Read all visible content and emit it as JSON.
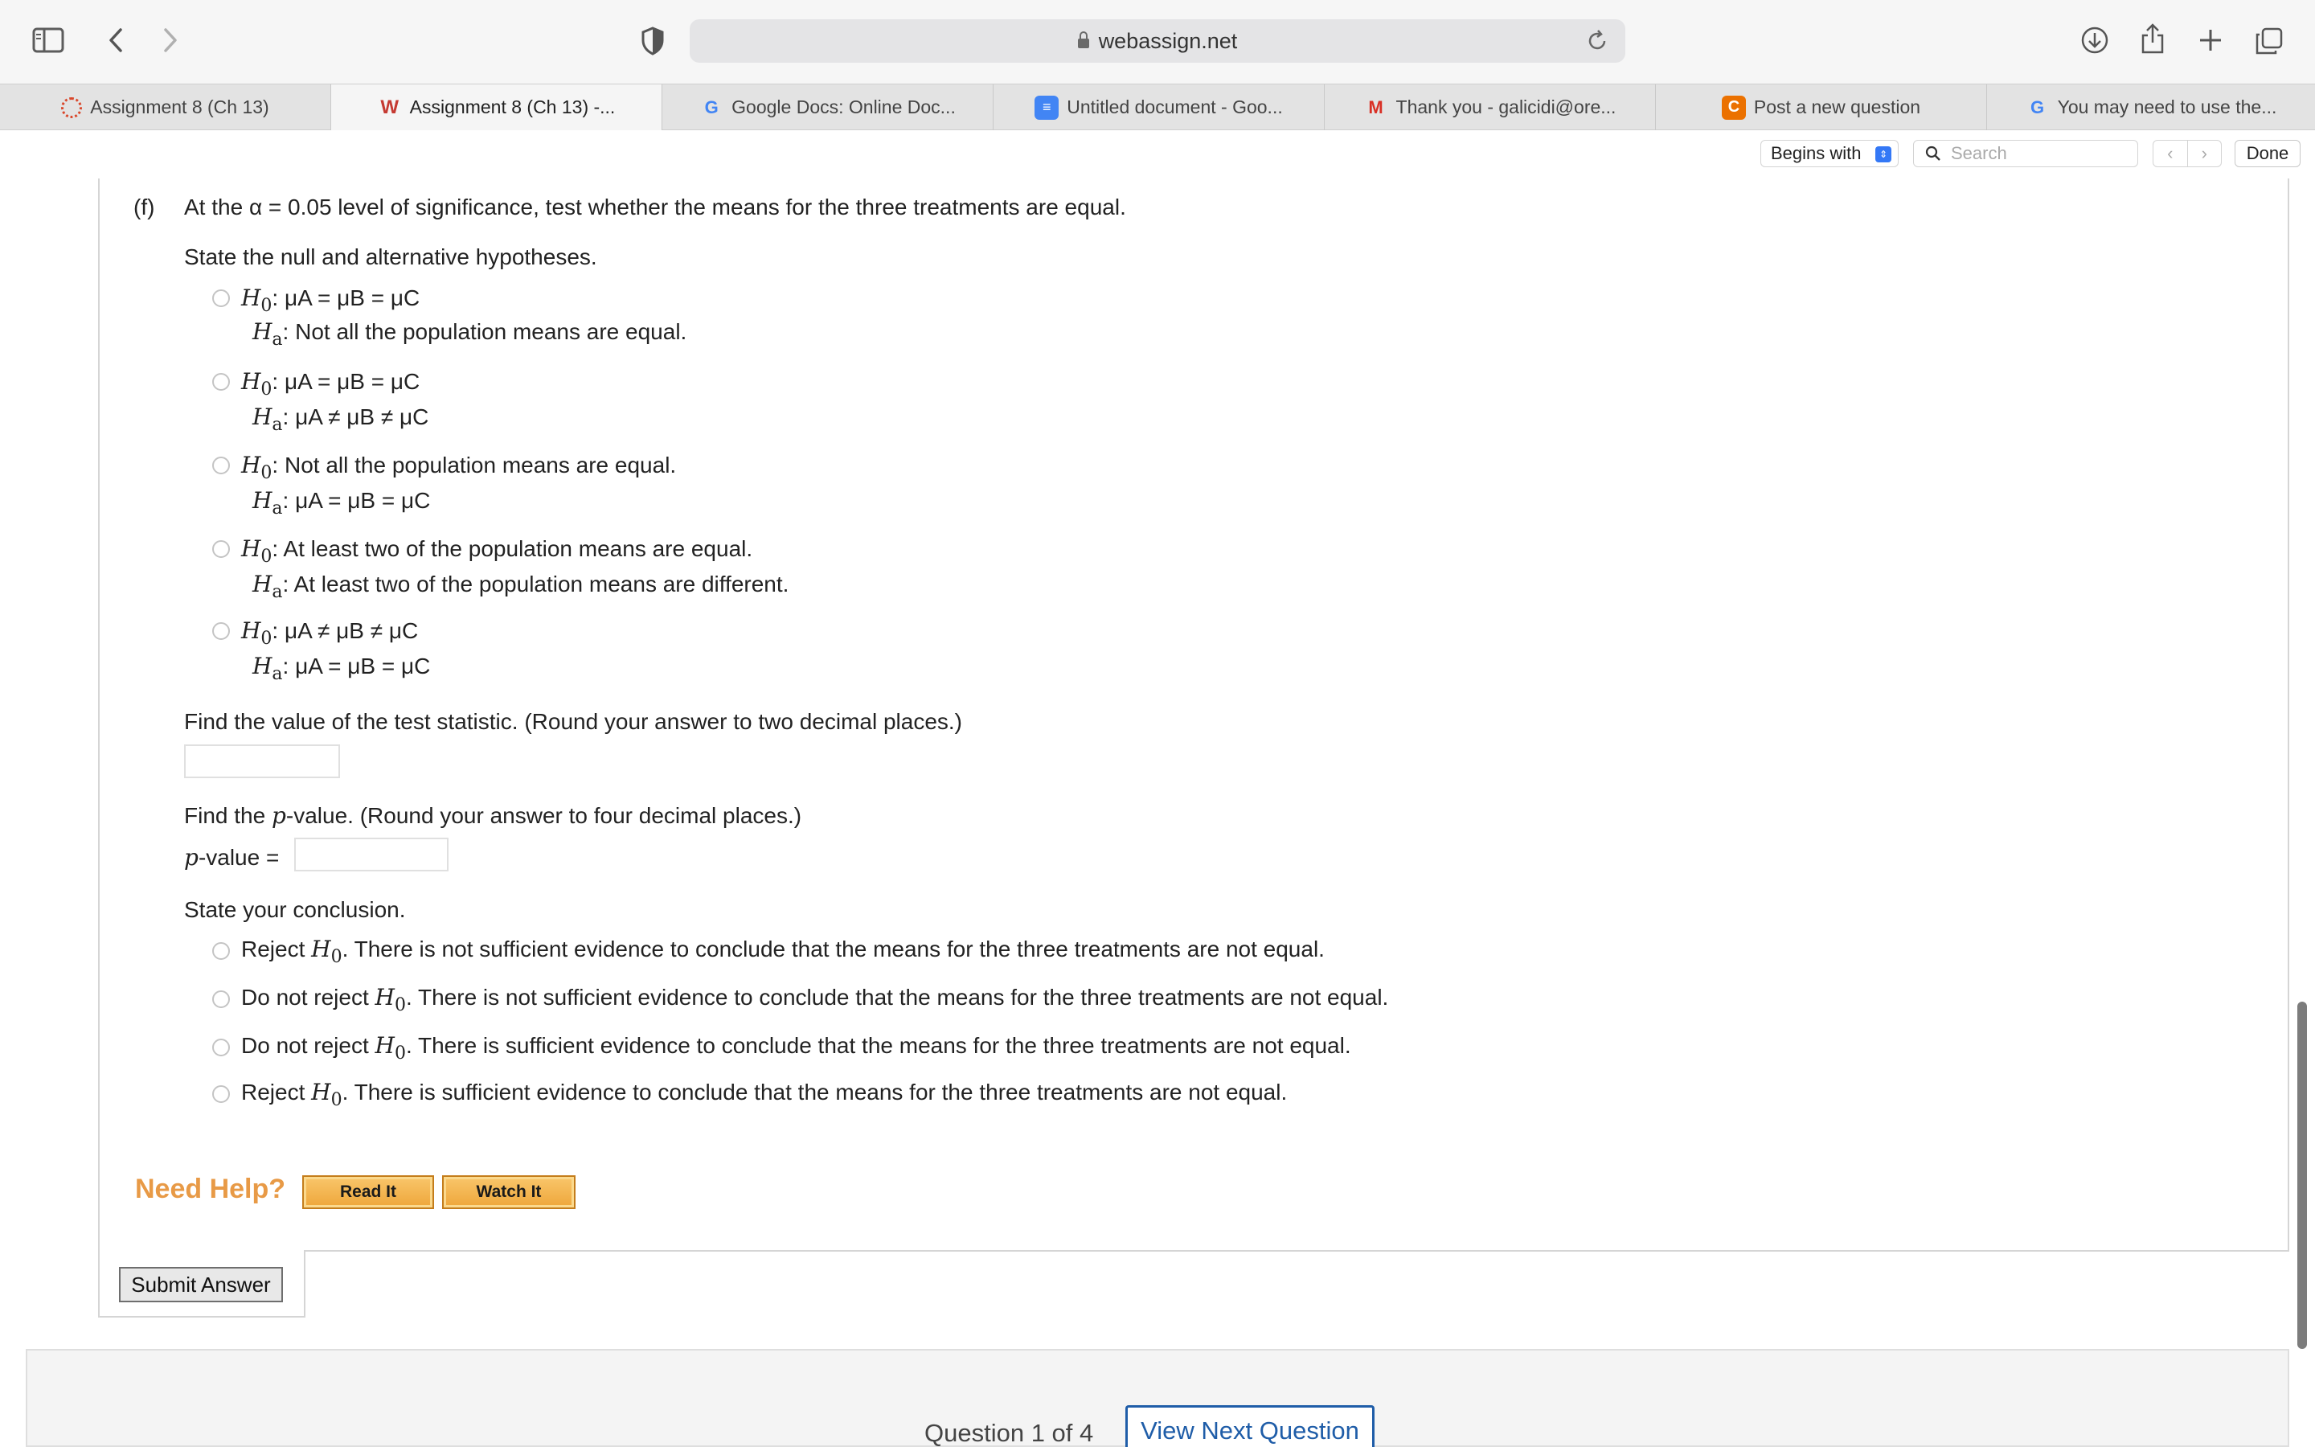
{
  "browser": {
    "url": "webassign.net"
  },
  "tabs": [
    {
      "label": "Assignment 8 (Ch 13)",
      "icon": "wa-gear-icon"
    },
    {
      "label": "Assignment 8 (Ch 13) -...",
      "icon": "wa-logo-icon"
    },
    {
      "label": "Google Docs: Online Doc...",
      "icon": "google-icon"
    },
    {
      "label": "Untitled document - Goo...",
      "icon": "docs-icon"
    },
    {
      "label": "Thank you - galicidi@ore...",
      "icon": "gmail-icon"
    },
    {
      "label": "Post a new question",
      "icon": "chegg-icon"
    },
    {
      "label": "You may need to use the...",
      "icon": "google-icon"
    }
  ],
  "findbar": {
    "mode": "Begins with",
    "search_placeholder": "Search",
    "done": "Done"
  },
  "question": {
    "part_label": "(f)",
    "prompt": "At the α = 0.05 level of significance, test whether the means for the three treatments are equal.",
    "hyp_heading": "State the null and alternative hypotheses.",
    "hypotheses": [
      {
        "h0": ": μA = μB = μC",
        "ha": ": Not all the population means are equal."
      },
      {
        "h0": ": μA = μB = μC",
        "ha": ": μA ≠ μB ≠ μC"
      },
      {
        "h0": ": Not all the population means are equal.",
        "ha": ": μA = μB = μC"
      },
      {
        "h0": ": At least two of the population means are equal.",
        "ha": ": At least two of the population means are different."
      },
      {
        "h0": ": μA ≠ μB ≠ μC",
        "ha": ": μA = μB = μC"
      }
    ],
    "test_stat_prompt": "Find the value of the test statistic. (Round your answer to two decimal places.)",
    "pvalue_prompt_pre": "Find the ",
    "pvalue_prompt_p": "p",
    "pvalue_prompt_post": "-value. (Round your answer to four decimal places.)",
    "pvalue_label_p": "p",
    "pvalue_label_post": "-value =",
    "conclusion_heading": "State your conclusion.",
    "conclusions": [
      {
        "pre": "Reject ",
        "post": ". There is not sufficient evidence to conclude that the means for the three treatments are not equal."
      },
      {
        "pre": "Do not reject ",
        "post": ". There is not sufficient evidence to conclude that the means for the three treatments are not equal."
      },
      {
        "pre": "Do not reject ",
        "post": ". There is sufficient evidence to conclude that the means for the three treatments are not equal."
      },
      {
        "pre": "Reject ",
        "post": ". There is sufficient evidence to conclude that the means for the three treatments are not equal."
      }
    ]
  },
  "help": {
    "label": "Need Help?",
    "read_it": "Read It",
    "watch_it": "Watch It"
  },
  "submit_label": "Submit Answer",
  "footer": {
    "count": "Question 1 of 4",
    "next": "View Next Question"
  }
}
